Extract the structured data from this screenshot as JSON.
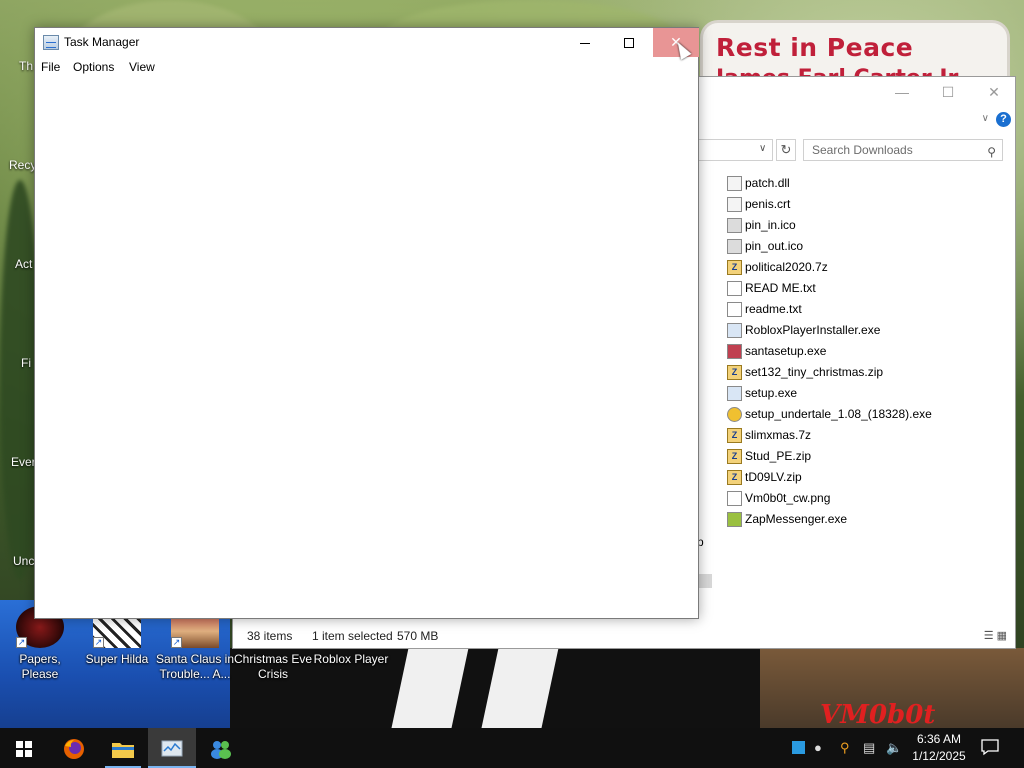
{
  "desktop": {
    "sign": {
      "line1": "Rest in Peace",
      "line2": "James Earl Carter Jr."
    },
    "watermark": "VM0b0t",
    "icons": [
      {
        "name": "papers-please",
        "label": "Papers, Please"
      },
      {
        "name": "super-hilda",
        "label": "Super Hilda"
      },
      {
        "name": "santa-claus",
        "label": "Santa Claus in Trouble... A..."
      },
      {
        "name": "christmas-eve-crisis",
        "label": "Christmas Eve Crisis"
      },
      {
        "name": "roblox-player",
        "label": "Roblox Player"
      }
    ],
    "edge_labels": [
      "Th",
      "Recy",
      "Act",
      "Fi",
      "Ever",
      "Unc"
    ]
  },
  "explorer": {
    "search_placeholder": "Search Downloads",
    "files": [
      {
        "name": "patch.dll",
        "type": "dll"
      },
      {
        "name": "penis.crt",
        "type": "crt"
      },
      {
        "name": "pin_in.ico",
        "type": "ico"
      },
      {
        "name": "pin_out.ico",
        "type": "ico"
      },
      {
        "name": "political2020.7z",
        "type": "zip"
      },
      {
        "name": "READ ME.txt",
        "type": "txt"
      },
      {
        "name": "readme.txt",
        "type": "txt"
      },
      {
        "name": "RobloxPlayerInstaller.exe",
        "type": "exe"
      },
      {
        "name": "santasetup.exe",
        "type": "exe"
      },
      {
        "name": "set132_tiny_christmas.zip",
        "type": "zip"
      },
      {
        "name": "setup.exe",
        "type": "exe"
      },
      {
        "name": "setup_undertale_1.08_(18328).exe",
        "type": "exe"
      },
      {
        "name": "slimxmas.7z",
        "type": "zip"
      },
      {
        "name": "Stud_PE.zip",
        "type": "zip"
      },
      {
        "name": "tD09LV.zip",
        "type": "zip"
      },
      {
        "name": "Vm0b0t_cw.png",
        "type": "png"
      },
      {
        "name": "ZapMessenger.exe",
        "type": "exe"
      }
    ],
    "status": {
      "items": "38 items",
      "selected": "1 item selected",
      "size": "570 MB"
    },
    "fragment": "p"
  },
  "taskmanager": {
    "title": "Task Manager",
    "menu": [
      "File",
      "Options",
      "View"
    ]
  },
  "taskbar": {
    "time": "6:36 AM",
    "date": "1/12/2025"
  }
}
